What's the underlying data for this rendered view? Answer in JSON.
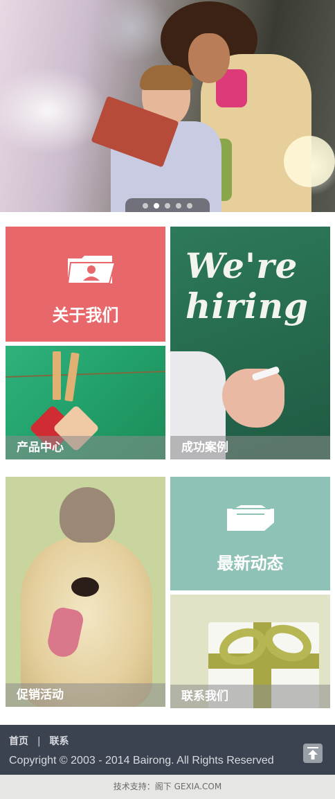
{
  "banner": {
    "slides_total": 5,
    "active_slide": 2
  },
  "tiles": {
    "about": {
      "label": "关于我们",
      "color": "#e8676a"
    },
    "products": {
      "label": "产品中心"
    },
    "hiring": {
      "headline_line1": "We're",
      "headline_line2": "hiring",
      "label": "成功案例"
    },
    "promo": {
      "label": "促销活动"
    },
    "news": {
      "label": "最新动态",
      "color": "#8fc2b7"
    },
    "contact": {
      "label": "联系我们"
    }
  },
  "footer": {
    "links": [
      "首页",
      "联系"
    ],
    "separator": "|",
    "copyright": "Copyright © 2003 - 2014 Bairong. All Rights Reserved",
    "bg_color": "#3b4250"
  },
  "support_text": "技术支持：阁下 GEXIA.COM",
  "icons": {
    "about": "folder-user-icon",
    "news": "news-tray-icon",
    "back_to_top": "arrow-up-icon"
  }
}
